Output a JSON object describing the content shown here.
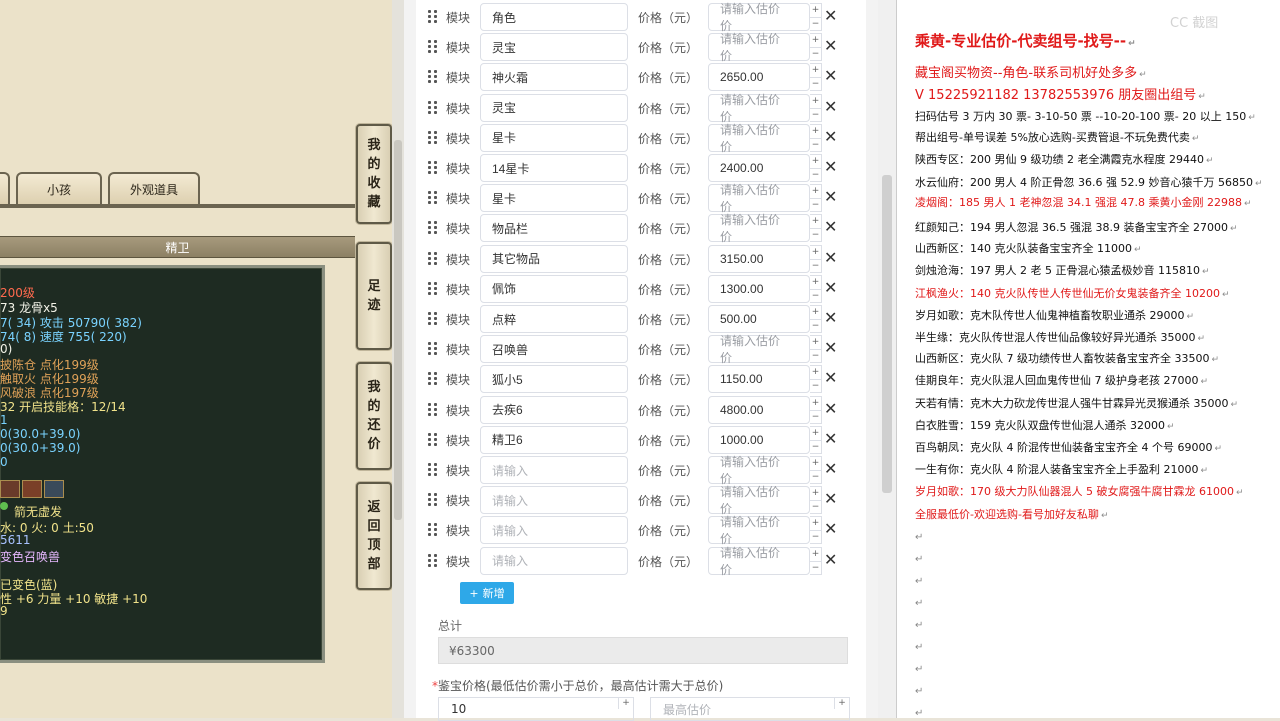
{
  "game": {
    "tabs": [
      "小孩",
      "外观道具"
    ],
    "section_title": "精卫",
    "side_buttons": [
      {
        "chars": [
          "我",
          "的",
          "收",
          "藏"
        ]
      },
      {
        "chars": [
          "足",
          "迹"
        ]
      },
      {
        "chars": [
          "我",
          "的",
          "还",
          "价"
        ]
      },
      {
        "chars": [
          "返",
          "回",
          "顶",
          "部"
        ]
      }
    ],
    "stats": [
      "200级",
      "73 龙骨x5",
      "7( 34) 攻击 50790( 382)",
      "74( 8) 速度 755( 220)",
      "0)",
      "披陈仓 点化199级",
      "触取火 点化199级",
      "风破浪 点化197级",
      "32 开启技能格：12/14",
      "1",
      "0(30.0+39.0)",
      "0(30.0+39.0)",
      "0",
      "箭无虚发",
      "水: 0 火: 0 土:50",
      "5611",
      "变色召唤兽",
      "已变色(蓝)",
      "性 +6 力量 +10 敏捷 +10",
      "9"
    ]
  },
  "form": {
    "module_label": "模块",
    "price_label": "价格（元）",
    "name_placeholder": "请输入",
    "price_placeholder": "请输入估价价",
    "rows": [
      {
        "name": "角色",
        "price": ""
      },
      {
        "name": "灵宝",
        "price": ""
      },
      {
        "name": "神火霜",
        "price": "2650.00"
      },
      {
        "name": "灵宝",
        "price": ""
      },
      {
        "name": "星卡",
        "price": ""
      },
      {
        "name": "14星卡",
        "price": "2400.00"
      },
      {
        "name": "星卡",
        "price": ""
      },
      {
        "name": "物品栏",
        "price": ""
      },
      {
        "name": "其它物品",
        "price": "3150.00"
      },
      {
        "name": "佩饰",
        "price": "1300.00"
      },
      {
        "name": "点粹",
        "price": "500.00"
      },
      {
        "name": "召唤兽",
        "price": ""
      },
      {
        "name": "狐小5",
        "price": "1150.00"
      },
      {
        "name": "去疾6",
        "price": "4800.00"
      },
      {
        "name": "精卫6",
        "price": "1000.00"
      },
      {
        "name": "",
        "price": ""
      },
      {
        "name": "",
        "price": ""
      },
      {
        "name": "",
        "price": ""
      },
      {
        "name": "",
        "price": ""
      }
    ],
    "add_label": "新增",
    "total_label": "总计",
    "total_value": "¥63300",
    "assess_label": "鉴宝价格(最低估价需小于总价，最高估计需大于总价)",
    "assess_required_mark": "*",
    "assess_min": "10",
    "assess_max_placeholder": "最高估价"
  },
  "doc": {
    "watermark": "CC 截图",
    "lines": [
      {
        "text": "乘黄-专业估价-代卖组号-找号--",
        "style": "big"
      },
      {
        "text": "藏宝阁买物资--角色-联系司机好处多多",
        "style": "med"
      },
      {
        "text": "V 15225921182        13782553976 朋友圈出组号",
        "style": "med"
      },
      {
        "text": "扫码估号 3 万内 30 票- 3-10-50 票  --10-20-100 票- 20 以上 150",
        "style": "black"
      },
      {
        "text": "帮出组号-单号误差 5%放心选购-买费管退-不玩免费代卖",
        "style": "black"
      },
      {
        "text": "陕西专区：200 男仙 9 级功绩 2 老全满霞克水程度 29440",
        "style": "black"
      },
      {
        "text": "水云仙府：200 男人 4 阶正骨忽 36.6 强 52.9 妙音心猿千万 56850",
        "style": "black"
      },
      {
        "text": "凌烟阁：185 男人 1 老神忽混 34.1 强混 47.8 乘黄小金刚 22988",
        "style": "red"
      },
      {
        "text": "红颜知己：194 男人忽混 36.5 强混 38.9 装备宝宝齐全 27000",
        "style": "black"
      },
      {
        "text": "山西新区：140 克火队装备宝宝齐全 11000",
        "style": "black"
      },
      {
        "text": "剑烛沧海：197 男人 2 老 5 正骨混心猿孟极妙音 115810",
        "style": "black"
      },
      {
        "text": "江枫渔火：140 克火队传世人传世仙无价女鬼装备齐全 10200",
        "style": "red"
      },
      {
        "text": "岁月如歌：克木队传世人仙鬼神植畜牧职业通杀 29000",
        "style": "black"
      },
      {
        "text": "半生缘：克火队传世混人传世仙品像较好异光通杀 35000",
        "style": "black"
      },
      {
        "text": "山西新区：克火队 7 级功绩传世人畜牧装备宝宝齐全 33500",
        "style": "black"
      },
      {
        "text": "佳期良年：克火队混人回血鬼传世仙 7 级护身老孩 27000",
        "style": "black"
      },
      {
        "text": "天若有情：克木大力砍龙传世混人强牛甘霖异光灵猴通杀 35000",
        "style": "black"
      },
      {
        "text": "白衣胜雪：159 克火队双盘传世仙混人通杀 32000",
        "style": "black"
      },
      {
        "text": "百鸟朝凤：克火队 4 阶混传世仙装备宝宝齐全 4 个号 69000",
        "style": "black"
      },
      {
        "text": "一生有你：克火队 4 阶混人装备宝宝齐全上手盈利 21000",
        "style": "black"
      },
      {
        "text": "岁月如歌：170 级大力队仙器混人 5 破女腐强牛腐甘霖龙 61000",
        "style": "red"
      },
      {
        "text": "全服最低价-欢迎选购-看号加好友私聊",
        "style": "red"
      }
    ]
  },
  "colors": {
    "accent": "#2ea8e8",
    "doc_red": "#e01919",
    "stat_bg": "#1e2b22"
  }
}
